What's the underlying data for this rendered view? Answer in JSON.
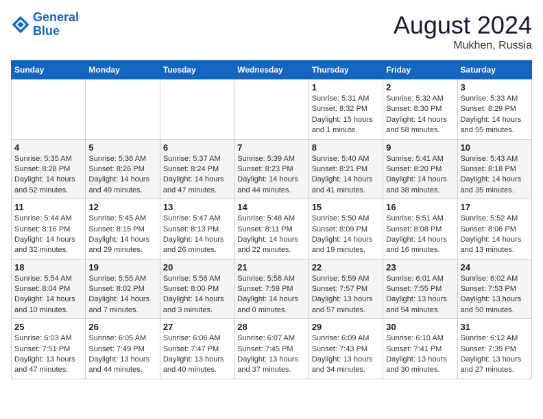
{
  "header": {
    "logo_line1": "General",
    "logo_line2": "Blue",
    "month_year": "August 2024",
    "location": "Mukhen, Russia"
  },
  "days_of_week": [
    "Sunday",
    "Monday",
    "Tuesday",
    "Wednesday",
    "Thursday",
    "Friday",
    "Saturday"
  ],
  "weeks": [
    [
      {
        "day": "",
        "sunrise": "",
        "sunset": "",
        "daylight": ""
      },
      {
        "day": "",
        "sunrise": "",
        "sunset": "",
        "daylight": ""
      },
      {
        "day": "",
        "sunrise": "",
        "sunset": "",
        "daylight": ""
      },
      {
        "day": "",
        "sunrise": "",
        "sunset": "",
        "daylight": ""
      },
      {
        "day": "1",
        "sunrise": "Sunrise: 5:31 AM",
        "sunset": "Sunset: 8:32 PM",
        "daylight": "Daylight: 15 hours and 1 minute."
      },
      {
        "day": "2",
        "sunrise": "Sunrise: 5:32 AM",
        "sunset": "Sunset: 8:30 PM",
        "daylight": "Daylight: 14 hours and 58 minutes."
      },
      {
        "day": "3",
        "sunrise": "Sunrise: 5:33 AM",
        "sunset": "Sunset: 8:29 PM",
        "daylight": "Daylight: 14 hours and 55 minutes."
      }
    ],
    [
      {
        "day": "4",
        "sunrise": "Sunrise: 5:35 AM",
        "sunset": "Sunset: 8:28 PM",
        "daylight": "Daylight: 14 hours and 52 minutes."
      },
      {
        "day": "5",
        "sunrise": "Sunrise: 5:36 AM",
        "sunset": "Sunset: 8:26 PM",
        "daylight": "Daylight: 14 hours and 49 minutes."
      },
      {
        "day": "6",
        "sunrise": "Sunrise: 5:37 AM",
        "sunset": "Sunset: 8:24 PM",
        "daylight": "Daylight: 14 hours and 47 minutes."
      },
      {
        "day": "7",
        "sunrise": "Sunrise: 5:39 AM",
        "sunset": "Sunset: 8:23 PM",
        "daylight": "Daylight: 14 hours and 44 minutes."
      },
      {
        "day": "8",
        "sunrise": "Sunrise: 5:40 AM",
        "sunset": "Sunset: 8:21 PM",
        "daylight": "Daylight: 14 hours and 41 minutes."
      },
      {
        "day": "9",
        "sunrise": "Sunrise: 5:41 AM",
        "sunset": "Sunset: 8:20 PM",
        "daylight": "Daylight: 14 hours and 38 minutes."
      },
      {
        "day": "10",
        "sunrise": "Sunrise: 5:43 AM",
        "sunset": "Sunset: 8:18 PM",
        "daylight": "Daylight: 14 hours and 35 minutes."
      }
    ],
    [
      {
        "day": "11",
        "sunrise": "Sunrise: 5:44 AM",
        "sunset": "Sunset: 8:16 PM",
        "daylight": "Daylight: 14 hours and 32 minutes."
      },
      {
        "day": "12",
        "sunrise": "Sunrise: 5:45 AM",
        "sunset": "Sunset: 8:15 PM",
        "daylight": "Daylight: 14 hours and 29 minutes."
      },
      {
        "day": "13",
        "sunrise": "Sunrise: 5:47 AM",
        "sunset": "Sunset: 8:13 PM",
        "daylight": "Daylight: 14 hours and 26 minutes."
      },
      {
        "day": "14",
        "sunrise": "Sunrise: 5:48 AM",
        "sunset": "Sunset: 8:11 PM",
        "daylight": "Daylight: 14 hours and 22 minutes."
      },
      {
        "day": "15",
        "sunrise": "Sunrise: 5:50 AM",
        "sunset": "Sunset: 8:09 PM",
        "daylight": "Daylight: 14 hours and 19 minutes."
      },
      {
        "day": "16",
        "sunrise": "Sunrise: 5:51 AM",
        "sunset": "Sunset: 8:08 PM",
        "daylight": "Daylight: 14 hours and 16 minutes."
      },
      {
        "day": "17",
        "sunrise": "Sunrise: 5:52 AM",
        "sunset": "Sunset: 8:06 PM",
        "daylight": "Daylight: 14 hours and 13 minutes."
      }
    ],
    [
      {
        "day": "18",
        "sunrise": "Sunrise: 5:54 AM",
        "sunset": "Sunset: 8:04 PM",
        "daylight": "Daylight: 14 hours and 10 minutes."
      },
      {
        "day": "19",
        "sunrise": "Sunrise: 5:55 AM",
        "sunset": "Sunset: 8:02 PM",
        "daylight": "Daylight: 14 hours and 7 minutes."
      },
      {
        "day": "20",
        "sunrise": "Sunrise: 5:56 AM",
        "sunset": "Sunset: 8:00 PM",
        "daylight": "Daylight: 14 hours and 3 minutes."
      },
      {
        "day": "21",
        "sunrise": "Sunrise: 5:58 AM",
        "sunset": "Sunset: 7:59 PM",
        "daylight": "Daylight: 14 hours and 0 minutes."
      },
      {
        "day": "22",
        "sunrise": "Sunrise: 5:59 AM",
        "sunset": "Sunset: 7:57 PM",
        "daylight": "Daylight: 13 hours and 57 minutes."
      },
      {
        "day": "23",
        "sunrise": "Sunrise: 6:01 AM",
        "sunset": "Sunset: 7:55 PM",
        "daylight": "Daylight: 13 hours and 54 minutes."
      },
      {
        "day": "24",
        "sunrise": "Sunrise: 6:02 AM",
        "sunset": "Sunset: 7:53 PM",
        "daylight": "Daylight: 13 hours and 50 minutes."
      }
    ],
    [
      {
        "day": "25",
        "sunrise": "Sunrise: 6:03 AM",
        "sunset": "Sunset: 7:51 PM",
        "daylight": "Daylight: 13 hours and 47 minutes."
      },
      {
        "day": "26",
        "sunrise": "Sunrise: 6:05 AM",
        "sunset": "Sunset: 7:49 PM",
        "daylight": "Daylight: 13 hours and 44 minutes."
      },
      {
        "day": "27",
        "sunrise": "Sunrise: 6:06 AM",
        "sunset": "Sunset: 7:47 PM",
        "daylight": "Daylight: 13 hours and 40 minutes."
      },
      {
        "day": "28",
        "sunrise": "Sunrise: 6:07 AM",
        "sunset": "Sunset: 7:45 PM",
        "daylight": "Daylight: 13 hours and 37 minutes."
      },
      {
        "day": "29",
        "sunrise": "Sunrise: 6:09 AM",
        "sunset": "Sunset: 7:43 PM",
        "daylight": "Daylight: 13 hours and 34 minutes."
      },
      {
        "day": "30",
        "sunrise": "Sunrise: 6:10 AM",
        "sunset": "Sunset: 7:41 PM",
        "daylight": "Daylight: 13 hours and 30 minutes."
      },
      {
        "day": "31",
        "sunrise": "Sunrise: 6:12 AM",
        "sunset": "Sunset: 7:39 PM",
        "daylight": "Daylight: 13 hours and 27 minutes."
      }
    ]
  ]
}
